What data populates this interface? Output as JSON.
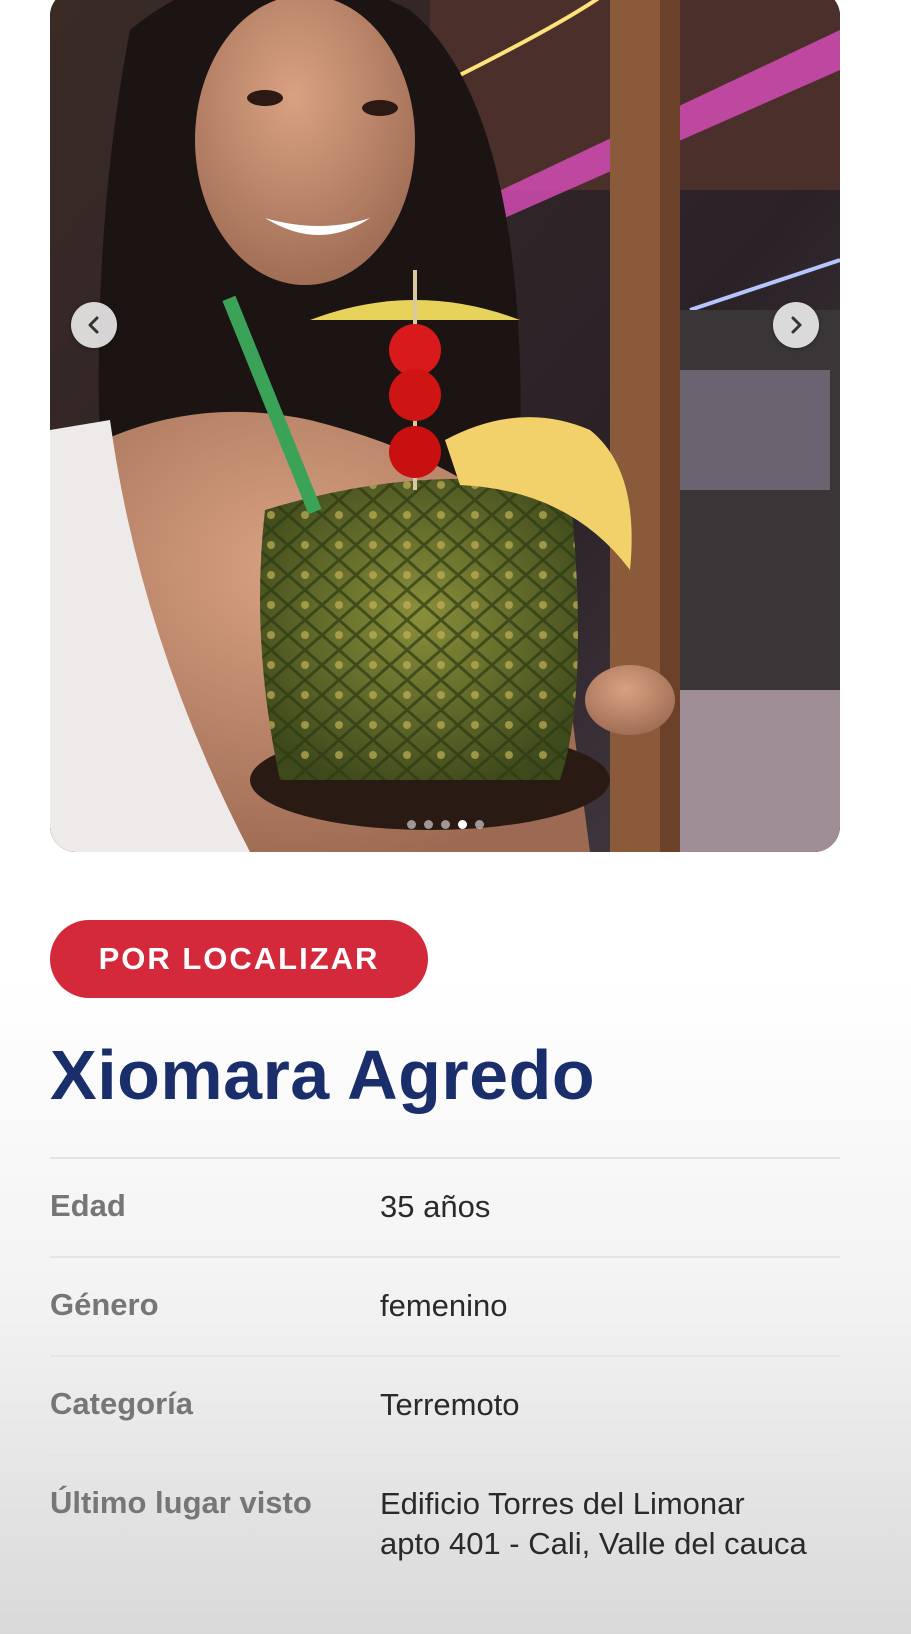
{
  "photo": {
    "description_icon": "photo",
    "prev_icon": "chevron-left-icon",
    "next_icon": "chevron-right-icon",
    "dots_total": 5,
    "dots_active_index": 3
  },
  "status": {
    "label": "POR LOCALIZAR",
    "color": "#d3293b"
  },
  "person": {
    "name": "Xiomara Agredo",
    "name_color": "#1a2e6b"
  },
  "details": [
    {
      "label": "Edad",
      "value": "35 años"
    },
    {
      "label": "Género",
      "value": "femenino"
    },
    {
      "label": "Categoría",
      "value": "Terremoto"
    },
    {
      "label": "Último lugar visto",
      "value": "Edificio Torres del Limonar apto 401 - Cali, Valle del cauca"
    }
  ]
}
